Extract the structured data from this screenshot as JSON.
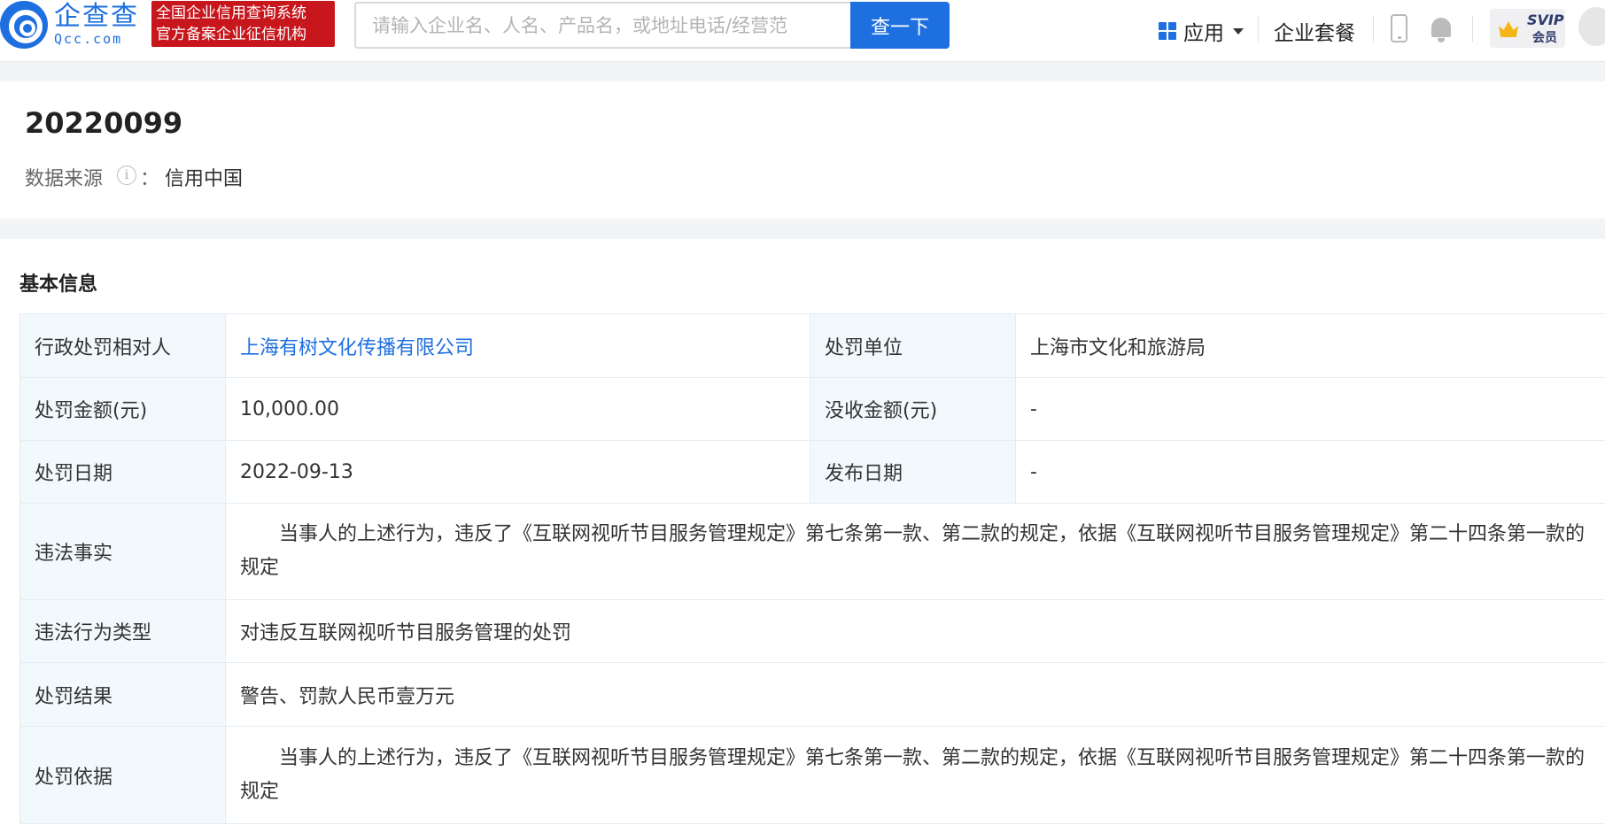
{
  "header": {
    "logo_cn": "企查查",
    "logo_en": "Qcc.com",
    "badge_line1": "全国企业信用查询系统",
    "badge_line2": "官方备案企业征信机构",
    "search_placeholder": "请输入企业名、人名、产品名，或地址电话/经营范",
    "search_button": "查一下",
    "apps_label": "应用",
    "plans_label": "企业套餐",
    "svip_line1": "SVIP",
    "svip_line2": "会员",
    "accent_color": "#1e6fe0",
    "badge_color": "#c8161d"
  },
  "record": {
    "title": "20220099",
    "source_label": "数据来源",
    "source_colon": "：",
    "source_value": "信用中国"
  },
  "basic_info": {
    "section_title": "基本信息",
    "party_label": "行政处罚相对人",
    "party_value": "上海有树文化传播有限公司",
    "authority_label": "处罚单位",
    "authority_value": "上海市文化和旅游局",
    "fine_label": "处罚金额(元)",
    "fine_value": "10,000.00",
    "confiscation_label": "没收金额(元)",
    "confiscation_value": "-",
    "date_label": "处罚日期",
    "date_value": "2022-09-13",
    "publish_label": "发布日期",
    "publish_value": "-",
    "facts_label": "违法事实",
    "facts_value": "当事人的上述行为，违反了《互联网视听节目服务管理规定》第七条第一款、第二款的规定，依据《互联网视听节目服务管理规定》第二十四条第一款的规定",
    "type_label": "违法行为类型",
    "type_value": "对违反互联网视听节目服务管理的处罚",
    "result_label": "处罚结果",
    "result_value": "警告、罚款人民币壹万元",
    "basis_label": "处罚依据",
    "basis_value": "当事人的上述行为，违反了《互联网视听节目服务管理规定》第七条第一款、第二款的规定，依据《互联网视听节目服务管理规定》第二十四条第一款的规定"
  }
}
